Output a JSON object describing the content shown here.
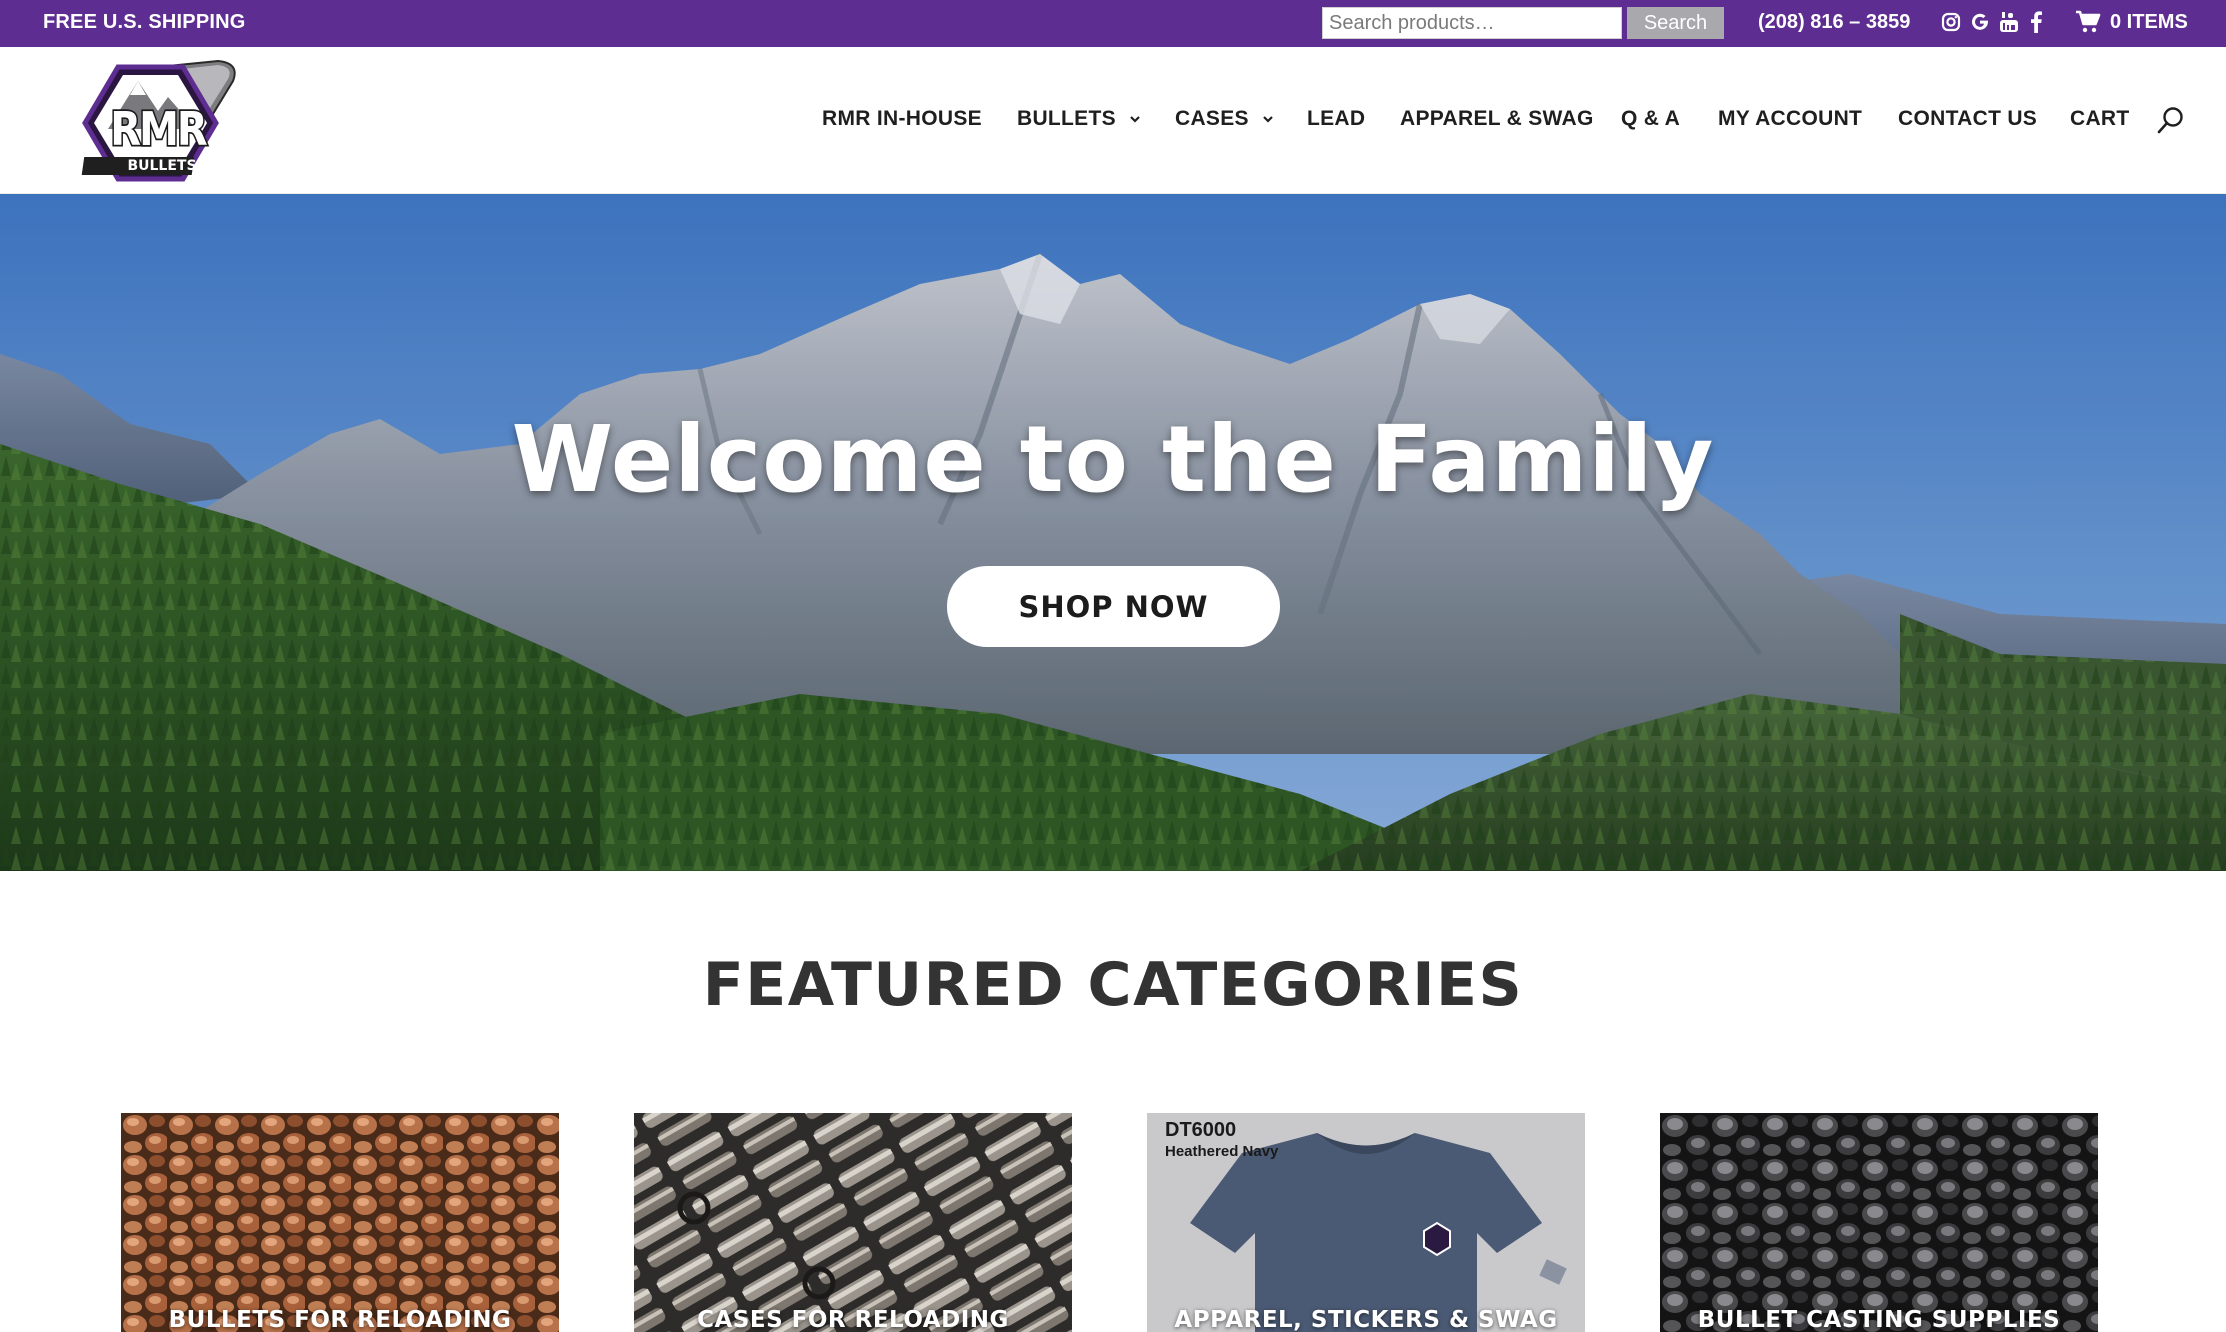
{
  "topbar": {
    "shipping_text": "FREE U.S. SHIPPING",
    "search_placeholder": "Search products…",
    "search_button": "Search",
    "phone": "(208) 816 – 3859",
    "social_icons": [
      "instagram-icon",
      "google-icon",
      "youtube-icon",
      "facebook-icon"
    ],
    "cart_items": "0 ITEMS"
  },
  "nav": {
    "items": [
      {
        "label": "RMR IN-HOUSE",
        "has_dropdown": false
      },
      {
        "label": "BULLETS",
        "has_dropdown": true
      },
      {
        "label": "CASES",
        "has_dropdown": true
      },
      {
        "label": "LEAD",
        "has_dropdown": false
      },
      {
        "label": "APPAREL & SWAG",
        "has_dropdown": false
      },
      {
        "label": "Q & A",
        "has_dropdown": false
      },
      {
        "label": "MY ACCOUNT",
        "has_dropdown": false
      },
      {
        "label": "CONTACT US",
        "has_dropdown": false
      },
      {
        "label": "CART",
        "has_dropdown": false
      }
    ]
  },
  "logo": {
    "line1": "RMR",
    "line2": "BULLETS"
  },
  "hero": {
    "title": "Welcome to the Family",
    "button": "SHOP NOW"
  },
  "featured": {
    "title": "FEATURED CATEGORIES",
    "categories": [
      {
        "label": "BULLETS FOR RELOADING"
      },
      {
        "label": "CASES FOR RELOADING"
      },
      {
        "label": "APPAREL, STICKERS & SWAG",
        "image_text_1": "DT6000",
        "image_text_2": "Heathered Navy"
      },
      {
        "label": "BULLET CASTING SUPPLIES"
      }
    ]
  },
  "colors": {
    "brand_purple": "#5e2d91",
    "search_button_gray": "#a9a9ad",
    "heading_gray": "#333333"
  }
}
